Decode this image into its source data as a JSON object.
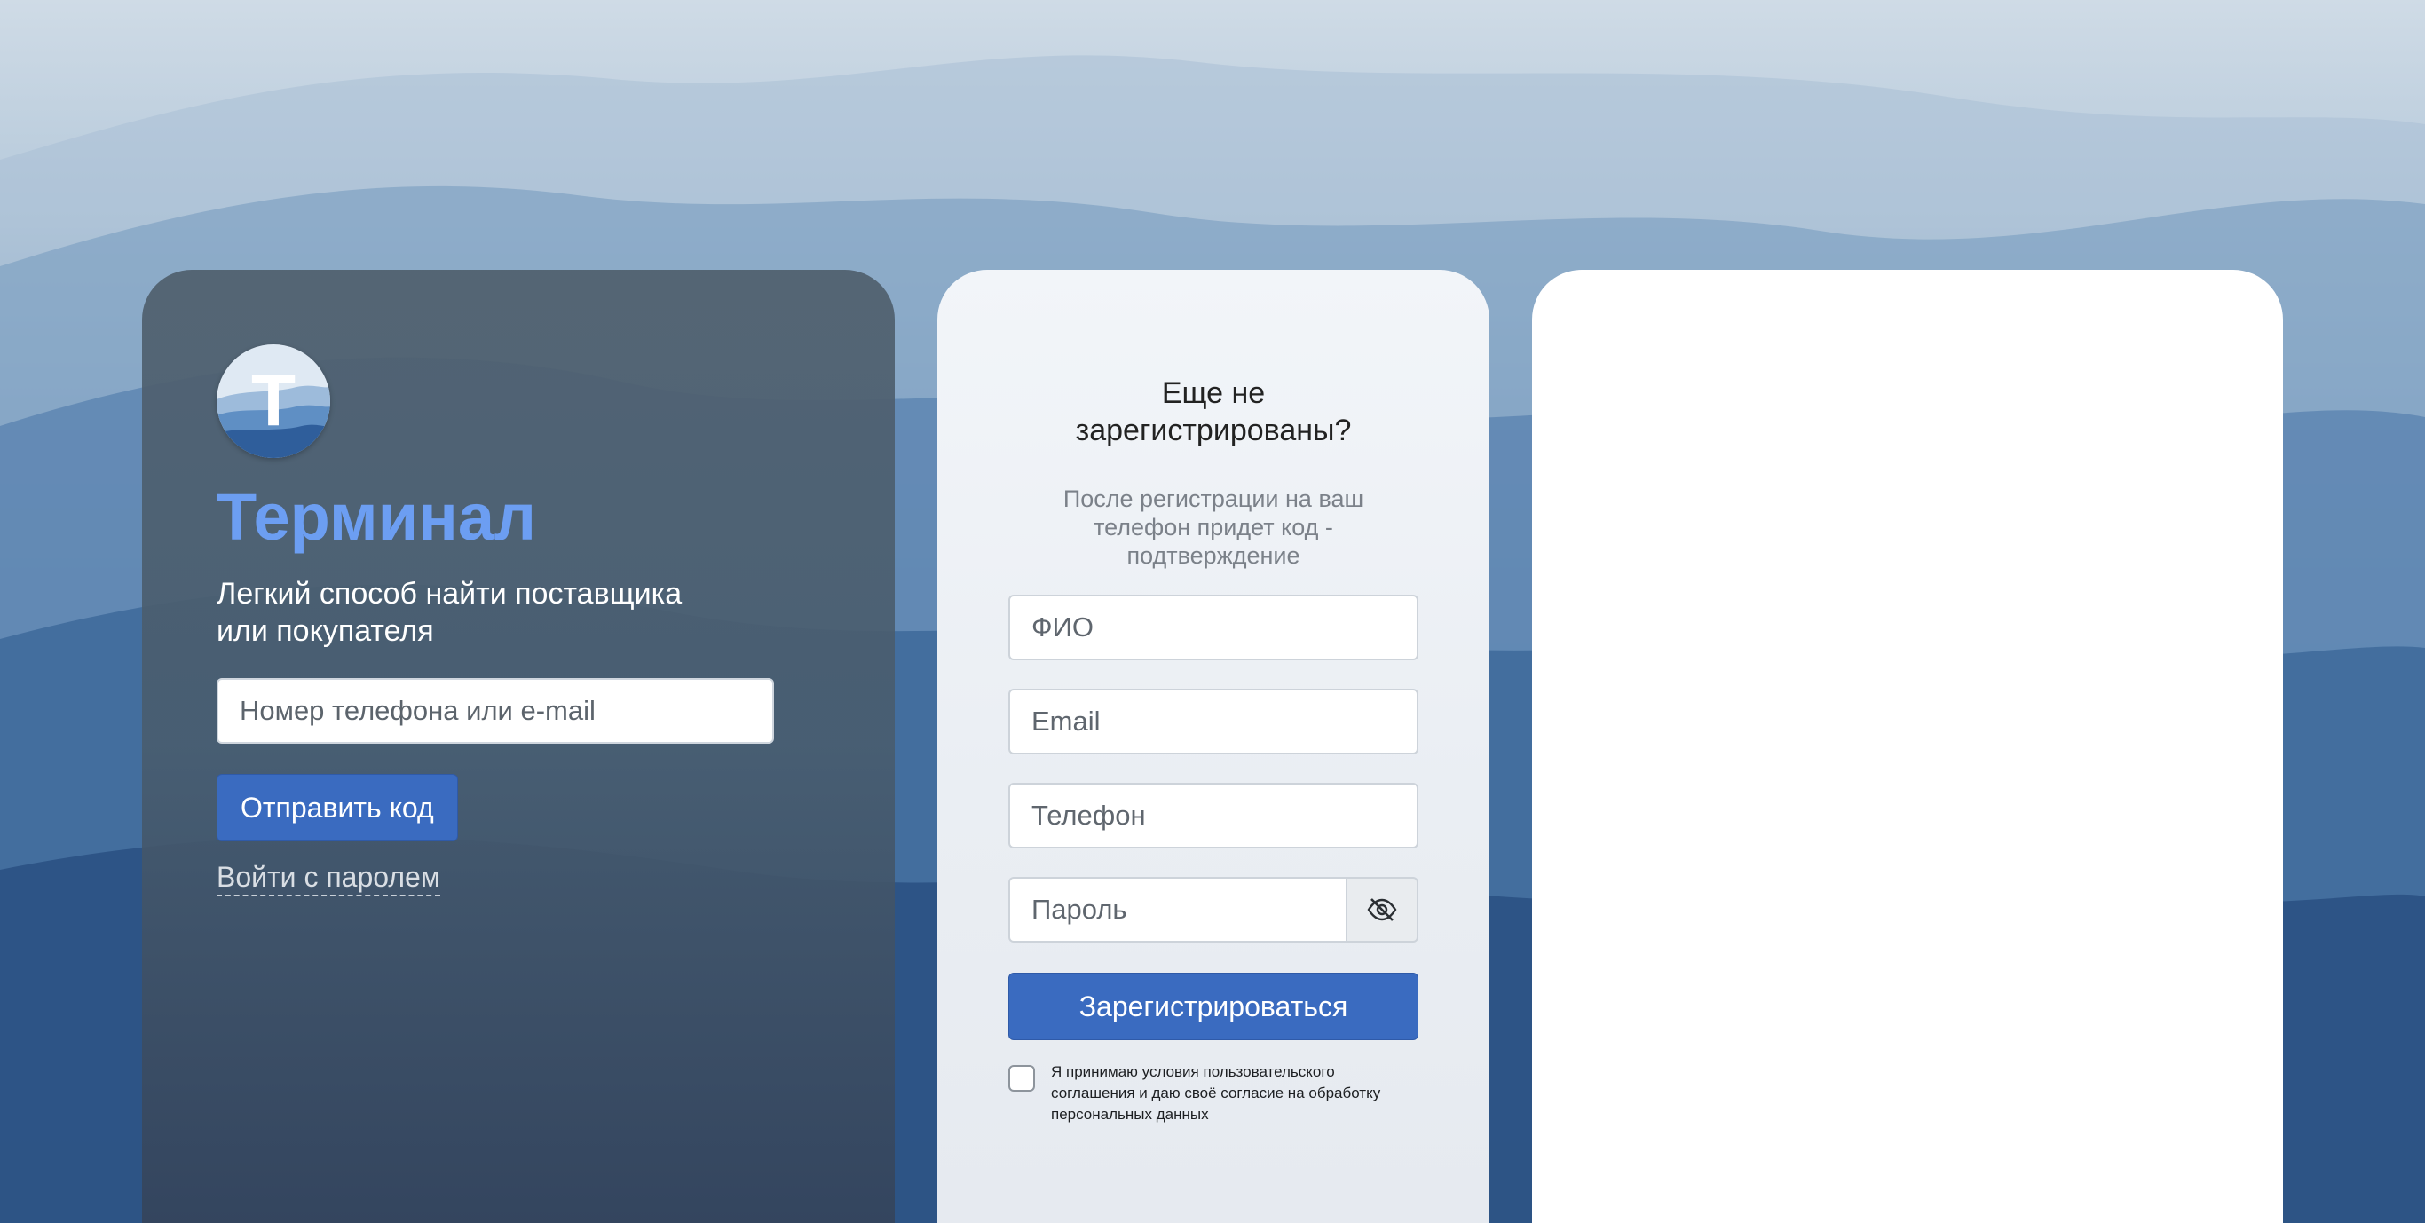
{
  "login": {
    "logo_letter": "Т",
    "title": "Терминал",
    "subtitle": "Легкий способ найти поставщика или покупателя",
    "input_placeholder": "Номер телефона или e-mail",
    "send_code_label": "Отправить код",
    "password_link": "Войти с паролем"
  },
  "register": {
    "title": "Еще не зарегистрированы?",
    "hint": "После регистрации на ваш телефон придет код - подтверждение",
    "fio_placeholder": "ФИО",
    "email_placeholder": "Email",
    "phone_placeholder": "Телефон",
    "password_placeholder": "Пароль",
    "submit_label": "Зарегистрироваться",
    "consent_text": "Я принимаю условия пользовательского соглашения и даю своё согласие на обработку персональных данных",
    "consent_checked": false
  },
  "icons": {
    "password_toggle": "eye-off-icon"
  },
  "colors": {
    "accent": "#3a6bc0",
    "brand_title": "#6c9ef2"
  }
}
